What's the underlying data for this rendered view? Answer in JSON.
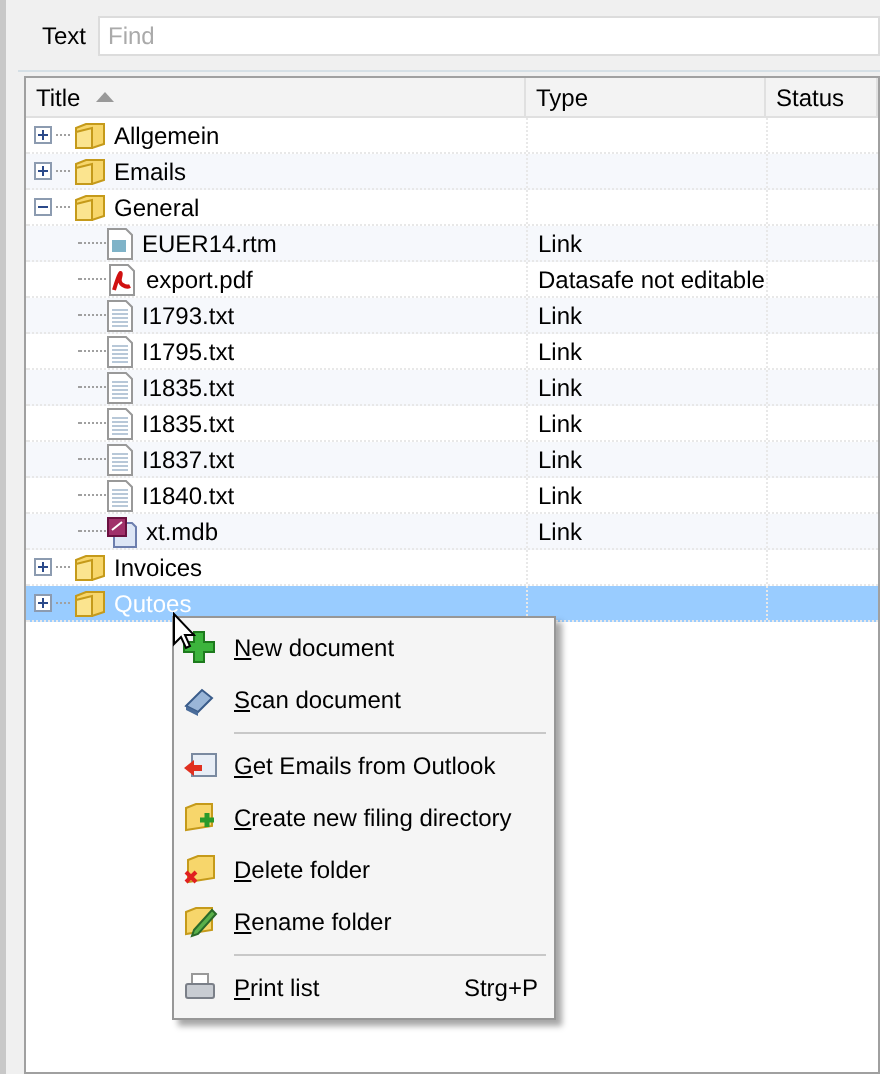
{
  "search": {
    "label": "Text",
    "placeholder": "Find"
  },
  "columns": [
    {
      "label": "Title",
      "sorted": true
    },
    {
      "label": "Type",
      "sorted": false
    },
    {
      "label": "Status",
      "sorted": false
    }
  ],
  "tree": [
    {
      "kind": "folder",
      "title": "Allgemein",
      "expanded": false,
      "selected": false
    },
    {
      "kind": "folder",
      "title": "Emails",
      "expanded": false,
      "selected": false
    },
    {
      "kind": "folder",
      "title": "General",
      "expanded": true,
      "selected": false,
      "children": [
        {
          "kind": "rtm",
          "title": "EUER14.rtm",
          "type": "Link",
          "selected": false
        },
        {
          "kind": "pdf",
          "title": "export.pdf",
          "type": "Datasafe not editable",
          "selected": false
        },
        {
          "kind": "txt",
          "title": "I1793.txt",
          "type": "Link",
          "selected": false
        },
        {
          "kind": "txt",
          "title": "I1795.txt",
          "type": "Link",
          "selected": false
        },
        {
          "kind": "txt",
          "title": "I1835.txt",
          "type": "Link",
          "selected": false
        },
        {
          "kind": "txt",
          "title": "I1835.txt",
          "type": "Link",
          "selected": false
        },
        {
          "kind": "txt",
          "title": "I1837.txt",
          "type": "Link",
          "selected": false
        },
        {
          "kind": "txt",
          "title": "I1840.txt",
          "type": "Link",
          "selected": false
        },
        {
          "kind": "mdb",
          "title": "xt.mdb",
          "type": "Link",
          "selected": false
        }
      ]
    },
    {
      "kind": "folder",
      "title": "Invoices",
      "expanded": false,
      "selected": false
    },
    {
      "kind": "folder",
      "title": "Qutoes",
      "expanded": false,
      "selected": true
    }
  ],
  "context_menu": [
    {
      "kind": "item",
      "label": "New document"
    },
    {
      "kind": "item",
      "label": "Scan document"
    },
    {
      "kind": "separator"
    },
    {
      "kind": "item",
      "label": "Get Emails from Outlook"
    },
    {
      "kind": "item",
      "label": "Create new filing directory"
    },
    {
      "kind": "item",
      "label": "Delete folder"
    },
    {
      "kind": "item",
      "label": "Rename folder"
    },
    {
      "kind": "separator"
    },
    {
      "kind": "item",
      "label": "Print list",
      "shortcut": "Strg+P"
    }
  ]
}
